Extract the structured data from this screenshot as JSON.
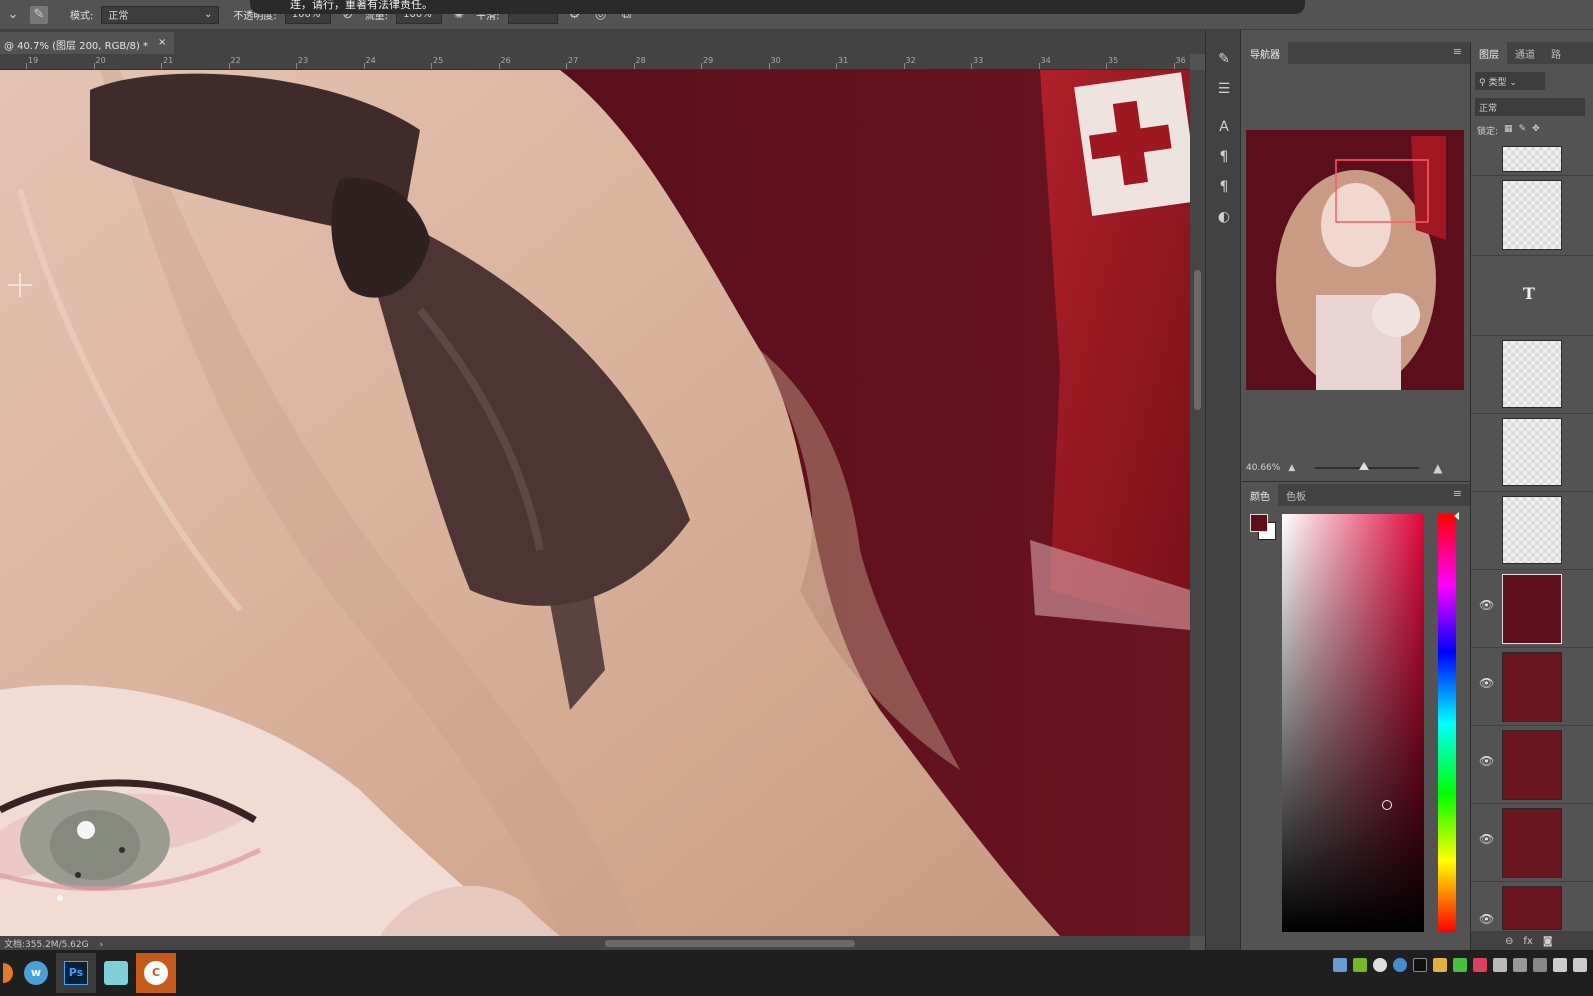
{
  "caption_overlay": "连，请行，重著有法律责任。",
  "options_bar": {
    "mode_label": "模式:",
    "mode_value": "正常",
    "opacity_label": "不透明度:",
    "opacity_value": "100%",
    "flow_label": "流量:",
    "flow_value": "100%",
    "smoothing_label": "平滑:"
  },
  "document_tab": {
    "title": "@ 40.7% (图层 200, RGB/8) *",
    "close": "×"
  },
  "ruler": {
    "ticks": [
      "19",
      "20",
      "21",
      "22",
      "23",
      "24",
      "25",
      "26",
      "27",
      "28",
      "29",
      "30",
      "31",
      "32",
      "33",
      "34",
      "35",
      "36"
    ]
  },
  "status": {
    "text": "文档:355.2M/5.62G",
    "arrow": "›"
  },
  "navigator": {
    "tab_label": "导航器",
    "zoom_value": "40.66%"
  },
  "color_panel": {
    "tabs": [
      "颜色",
      "色板"
    ],
    "foreground_color": "#5c0f1b",
    "background_color": "#ffffff"
  },
  "layers_panel": {
    "tabs": [
      "图层",
      "通道",
      "路"
    ],
    "filter_value": "类型",
    "blend_value": "正常",
    "lock_label": "锁定:",
    "text_layer_glyph": "T"
  },
  "taskbar": {
    "apps": [
      "w",
      "Ps",
      "",
      "C"
    ]
  },
  "colors": {
    "canvas_bg": "#5b0f1a",
    "hair": "#d9b7a3",
    "bow": "#4a3432",
    "panel": "#535353"
  }
}
